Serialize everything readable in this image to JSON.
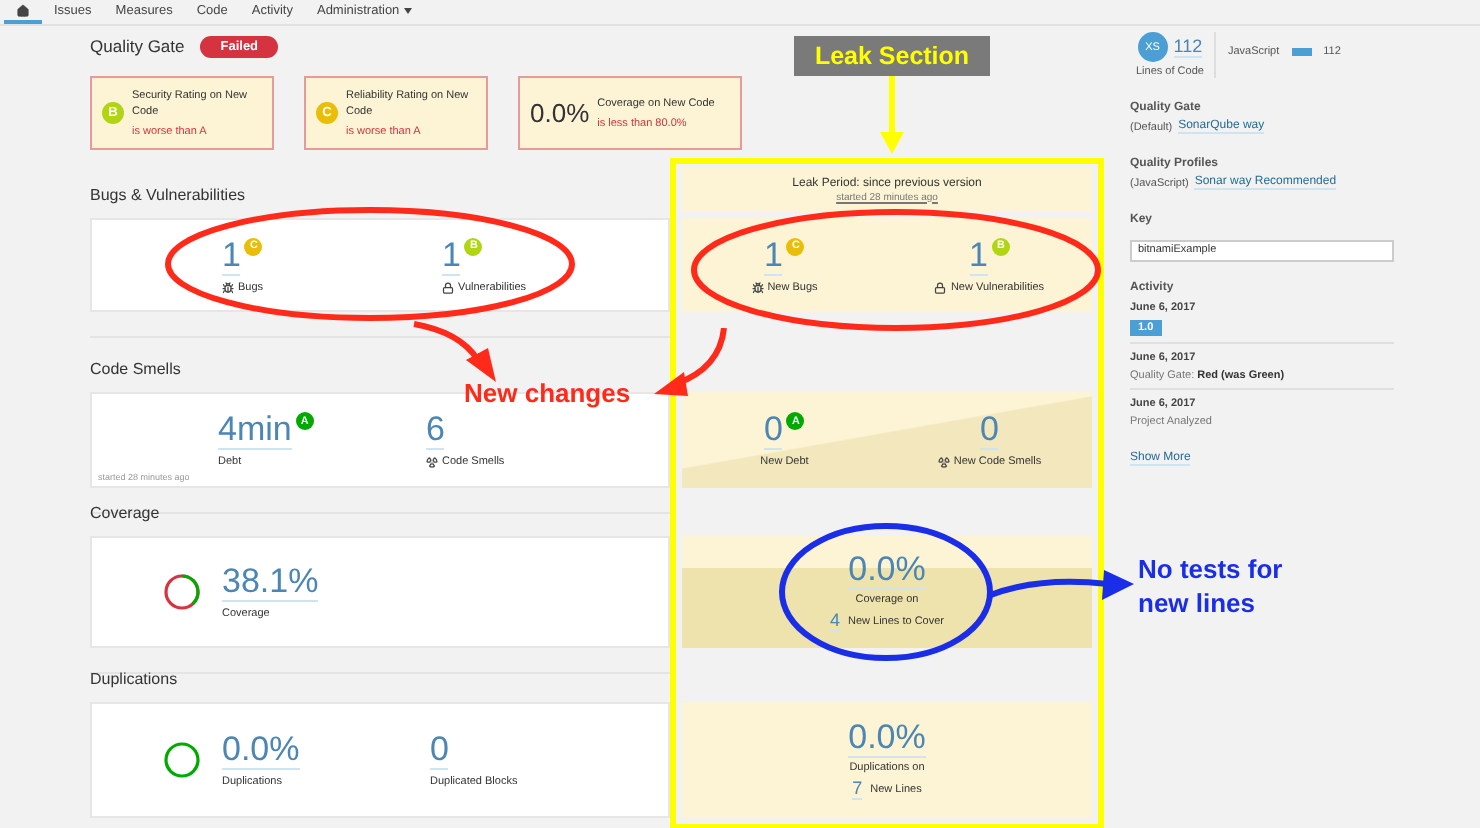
{
  "nav": {
    "tabs": [
      {
        "kind": "home",
        "selected": true
      },
      {
        "kind": "text",
        "label": "Issues",
        "selected": false
      },
      {
        "kind": "text",
        "label": "Measures",
        "selected": false
      },
      {
        "kind": "text",
        "label": "Code",
        "selected": false
      },
      {
        "kind": "text",
        "label": "Activity",
        "selected": false
      },
      {
        "kind": "menu",
        "label": "Administration",
        "selected": false
      }
    ]
  },
  "quality_gate": {
    "title": "Quality Gate",
    "status": "Failed",
    "conditions": [
      {
        "kind": "rating",
        "rating": "B",
        "color": "#b0d513",
        "label": "Security Rating on New Code",
        "message": "is worse than A"
      },
      {
        "kind": "rating",
        "rating": "C",
        "color": "#eabe06",
        "label": "Reliability Rating on New Code",
        "message": "is worse than A"
      },
      {
        "kind": "value",
        "value": "0.0%",
        "label": "Coverage on New Code",
        "message": "is less than 80.0%"
      }
    ]
  },
  "leak_period": {
    "title": "Leak Period: since previous version",
    "started": "started 28 minutes ago"
  },
  "sections": [
    {
      "kind": "issues",
      "title": "Bugs & Vulnerabilities",
      "measures": [
        {
          "value": "1",
          "rating": "C",
          "color": "#eabe06",
          "label": "Bugs"
        },
        {
          "value": "1",
          "rating": "B",
          "color": "#b0d513",
          "label": "Vulnerabilities"
        }
      ],
      "leak": {
        "measures": [
          {
            "value": "1",
            "rating": "C",
            "color": "#eabe06",
            "label": "New Bugs"
          },
          {
            "value": "1",
            "rating": "B",
            "color": "#b0d513",
            "label": "New Vulnerabilities"
          }
        ]
      }
    },
    {
      "kind": "smells",
      "title": "Code Smells",
      "note": "started 28 minutes ago",
      "measures": [
        {
          "value": "4min",
          "rating": "A",
          "color": "#00aa00",
          "label": "Debt"
        },
        {
          "value": "6",
          "label": "Code Smells"
        }
      ],
      "leak": {
        "measures": [
          {
            "value": "0",
            "rating": "A",
            "color": "#00aa00",
            "label": "New Debt"
          },
          {
            "value": "0",
            "label": "New Code Smells"
          }
        ]
      }
    },
    {
      "kind": "coverage",
      "title": "Coverage",
      "ring": {
        "level": 0.381
      },
      "measures": [
        {
          "value": "38.1%",
          "label": "Coverage"
        }
      ],
      "leak": {
        "value": "0.0%",
        "label": "Coverage on",
        "count": "4",
        "count_label": "New Lines to Cover"
      }
    },
    {
      "kind": "duplications",
      "title": "Duplications",
      "measures": [
        {
          "value": "0.0%",
          "label": "Duplications"
        },
        {
          "value": "0",
          "label": "Duplicated Blocks"
        }
      ],
      "leak": {
        "value": "0.0%",
        "label": "Duplications on",
        "count": "7",
        "count_label": "New Lines"
      }
    }
  ],
  "sidebar": {
    "loc": {
      "size": "XS",
      "value": "112",
      "label": "Lines of Code",
      "languages": [
        {
          "name": "JavaScript",
          "value": "112"
        }
      ]
    },
    "quality_gate": {
      "title": "Quality Gate",
      "prefix": "(Default)",
      "link": "SonarQube way"
    },
    "quality_profiles": {
      "title": "Quality Profiles",
      "prefix": "(JavaScript)",
      "link": "Sonar way Recommended"
    },
    "key": {
      "title": "Key",
      "value": "bitnamiExample"
    },
    "activity": {
      "title": "Activity",
      "events": [
        {
          "date": "June 6, 2017",
          "kind": "version",
          "text": "1.0"
        },
        {
          "date": "June 6, 2017",
          "kind": "text",
          "text": "Quality Gate: **Red (was Green)**"
        },
        {
          "date": "June 6, 2017",
          "kind": "text",
          "text": "Project Analyzed"
        }
      ],
      "show_more": "Show More"
    }
  },
  "annotations": {
    "leak_label": "Leak Section",
    "new_changes": "New changes",
    "no_tests": "No tests for new lines"
  }
}
